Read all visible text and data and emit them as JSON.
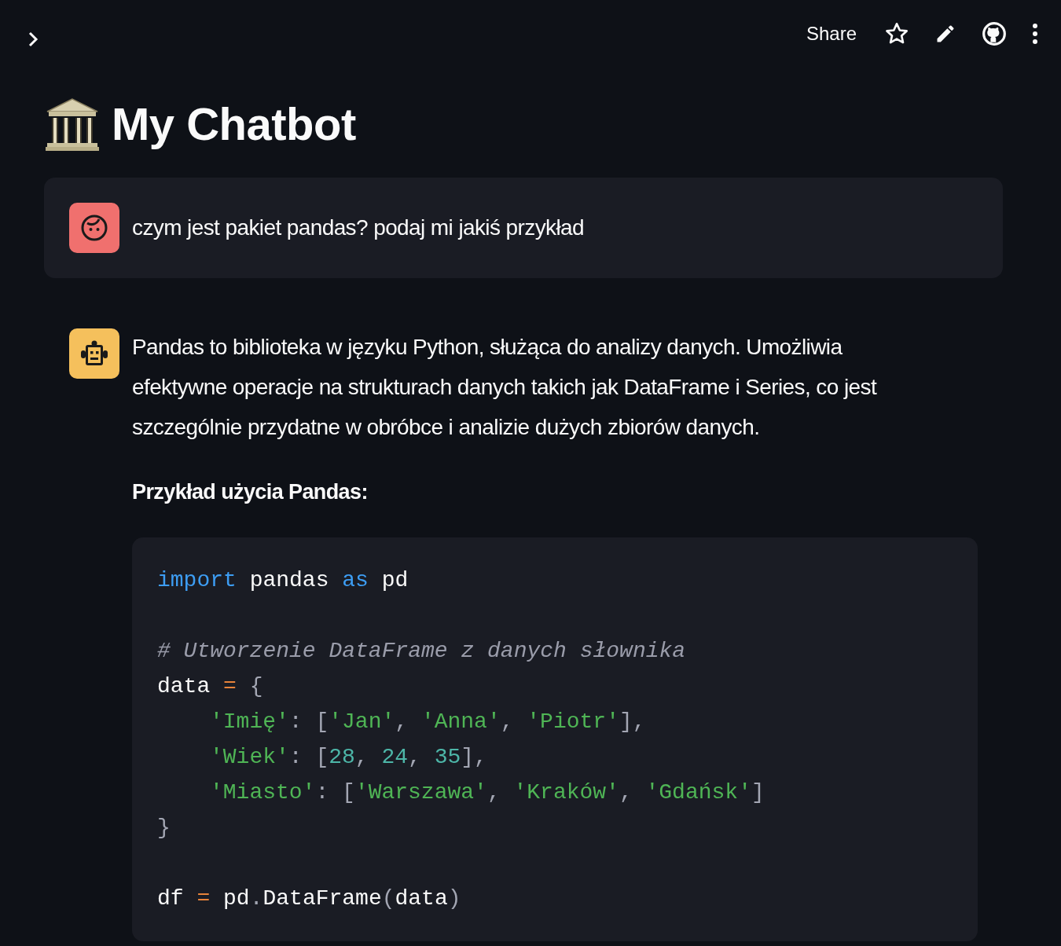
{
  "header": {
    "share": "Share"
  },
  "title": "My Chatbot",
  "messages": [
    {
      "kind": "user",
      "paragraphs": [
        {
          "kind": "text",
          "text": "czym jest pakiet pandas? podaj mi jakiś przykład"
        }
      ]
    },
    {
      "kind": "assistant",
      "paragraphs": [
        {
          "kind": "text",
          "text": "Pandas to biblioteka w języku Python, służąca do analizy danych. Umożliwia efektywne operacje na strukturach danych takich jak DataFrame i Series, co jest szczególnie przydatne w obróbce i analizie dużych zbiorów danych."
        },
        {
          "kind": "heading",
          "text": "Przykład użycia Pandas:"
        },
        {
          "kind": "code",
          "lines": [
            {
              "kind": "code",
              "tokens": [
                {
                  "kind": "keyword",
                  "text": "import"
                },
                {
                  "kind": "plain",
                  "text": " pandas "
                },
                {
                  "kind": "keyword",
                  "text": "as"
                },
                {
                  "kind": "plain",
                  "text": " pd"
                }
              ]
            },
            {
              "kind": "blank"
            },
            {
              "kind": "code",
              "tokens": [
                {
                  "kind": "comment",
                  "text": "# Utworzenie DataFrame z danych słownika"
                }
              ]
            },
            {
              "kind": "code",
              "tokens": [
                {
                  "kind": "plain",
                  "text": "data "
                },
                {
                  "kind": "operator",
                  "text": "="
                },
                {
                  "kind": "punct",
                  "text": " {"
                }
              ]
            },
            {
              "kind": "indented",
              "tokens": [
                {
                  "kind": "string",
                  "text": "'Imię'"
                },
                {
                  "kind": "punct",
                  "text": ": ["
                },
                {
                  "kind": "string",
                  "text": "'Jan'"
                },
                {
                  "kind": "punct",
                  "text": ", "
                },
                {
                  "kind": "string",
                  "text": "'Anna'"
                },
                {
                  "kind": "punct",
                  "text": ", "
                },
                {
                  "kind": "string",
                  "text": "'Piotr'"
                },
                {
                  "kind": "punct",
                  "text": "],"
                }
              ]
            },
            {
              "kind": "indented",
              "tokens": [
                {
                  "kind": "string",
                  "text": "'Wiek'"
                },
                {
                  "kind": "punct",
                  "text": ": ["
                },
                {
                  "kind": "number",
                  "text": "28"
                },
                {
                  "kind": "punct",
                  "text": ", "
                },
                {
                  "kind": "number",
                  "text": "24"
                },
                {
                  "kind": "punct",
                  "text": ", "
                },
                {
                  "kind": "number",
                  "text": "35"
                },
                {
                  "kind": "punct",
                  "text": "],"
                }
              ]
            },
            {
              "kind": "indented",
              "tokens": [
                {
                  "kind": "string",
                  "text": "'Miasto'"
                },
                {
                  "kind": "punct",
                  "text": ": ["
                },
                {
                  "kind": "string",
                  "text": "'Warszawa'"
                },
                {
                  "kind": "punct",
                  "text": ", "
                },
                {
                  "kind": "string",
                  "text": "'Kraków'"
                },
                {
                  "kind": "punct",
                  "text": ", "
                },
                {
                  "kind": "string",
                  "text": "'Gdańsk'"
                },
                {
                  "kind": "punct",
                  "text": "]"
                }
              ]
            },
            {
              "kind": "code",
              "tokens": [
                {
                  "kind": "punct",
                  "text": "}"
                }
              ]
            },
            {
              "kind": "blank"
            },
            {
              "kind": "code",
              "tokens": [
                {
                  "kind": "plain",
                  "text": "df "
                },
                {
                  "kind": "operator",
                  "text": "="
                },
                {
                  "kind": "plain",
                  "text": " pd"
                },
                {
                  "kind": "punct",
                  "text": "."
                },
                {
                  "kind": "plain",
                  "text": "DataFrame"
                },
                {
                  "kind": "punct",
                  "text": "("
                },
                {
                  "kind": "plain",
                  "text": "data"
                },
                {
                  "kind": "punct",
                  "text": ")"
                }
              ]
            }
          ]
        }
      ]
    }
  ]
}
